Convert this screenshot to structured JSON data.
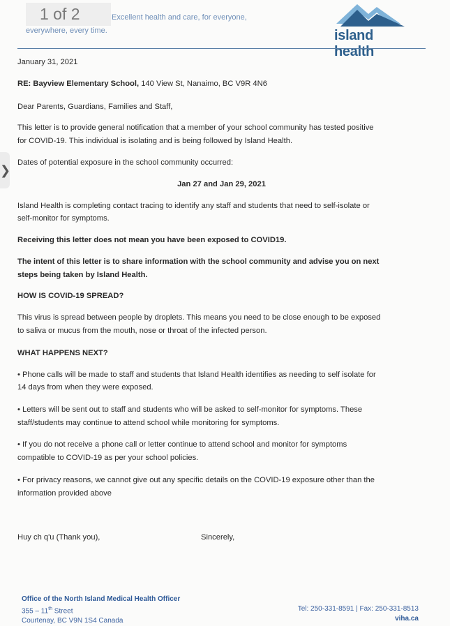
{
  "pager": {
    "label": "1 of 2"
  },
  "header": {
    "tagline_line1": "Excellent health and care, for everyone,",
    "tagline_line2": "everywhere, every time.",
    "brand": "island health"
  },
  "letter": {
    "date": "January 31, 2021",
    "re_label": "RE: Bayview Elementary School,",
    "re_address": " 140 View St, Nanaimo, BC V9R 4N6",
    "salutation": "Dear Parents, Guardians, Families and Staff,",
    "p1_line1": "This letter is to provide general notification that a member of your school community has tested positive",
    "p1_line2": "for COVID-19. This individual is isolating and is being followed by Island Health.",
    "p2": "Dates of potential exposure in the school community occurred:",
    "dates": "Jan 27 and Jan 29, 2021",
    "p3_line1": "Island Health is completing contact tracing to identify any staff and students that need to self-isolate or",
    "p3_line2": "self-monitor for symptoms.",
    "bold1": "Receiving this letter does not mean you have been exposed to COVID19.",
    "bold2_line1": "The intent of this letter is to share information with the school community and advise you on next",
    "bold2_line2": "steps being taken by Island Health.",
    "heading1": "HOW IS COVID-19 SPREAD?",
    "p4_line1": "This virus is spread between people by droplets. This means you need to be close enough to be exposed",
    "p4_line2": "to saliva or mucus from the mouth, nose or throat of the infected person.",
    "heading2": "WHAT HAPPENS NEXT?",
    "bullet1_line1": "• Phone calls will be made to staff and students that Island Health identifies as needing to self isolate for",
    "bullet1_line2": "14 days from when they were exposed.",
    "bullet2_line1": "• Letters will be sent out to staff and students who will be asked to self-monitor for symptoms. These",
    "bullet2_line2": "staff/students may continue to attend school while monitoring for symptoms.",
    "bullet3_line1": "• If you do not receive a phone call or letter continue to attend school and monitor for symptoms",
    "bullet3_line2": "compatible to COVID-19 as per your school policies.",
    "bullet4_line1": "• For privacy reasons, we cannot give out any specific details on the COVID-19 exposure other than the",
    "bullet4_line2": "information provided above",
    "closing_left": "Huy ch q'u (Thank you),",
    "closing_right": "Sincerely,"
  },
  "footer": {
    "office": "Office of the North Island Medical Health Officer",
    "street_num": "355 – 11",
    "street_sup": "th",
    "street_rest": " Street",
    "city": "Courtenay, BC  V9N 1S4   Canada",
    "contact": "Tel: 250-331-8591 | Fax: 250-331-8513",
    "web": "viha.ca"
  },
  "colors": {
    "brand_blue": "#2d5f8c",
    "mountain_light": "#7fb3d9",
    "footer_blue": "#3c62a0"
  }
}
